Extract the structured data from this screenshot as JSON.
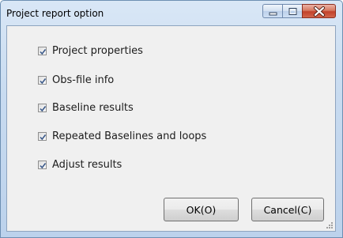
{
  "window": {
    "title": "Project report option"
  },
  "caption_buttons": {
    "minimize_icon": "minimize-icon",
    "maximize_icon": "maximize-icon",
    "close_icon": "close-icon"
  },
  "options": [
    {
      "label": "Project properties",
      "checked": true
    },
    {
      "label": "Obs-file info",
      "checked": true
    },
    {
      "label": "Baseline results",
      "checked": true
    },
    {
      "label": "Repeated Baselines and loops",
      "checked": true
    },
    {
      "label": "Adjust results",
      "checked": true
    }
  ],
  "buttons": {
    "ok_label": "OK(O)",
    "cancel_label": "Cancel(C)"
  },
  "colors": {
    "title_bar": "#c8dbf0",
    "client_background": "#f0f0f0",
    "close_button": "#c2412a"
  }
}
